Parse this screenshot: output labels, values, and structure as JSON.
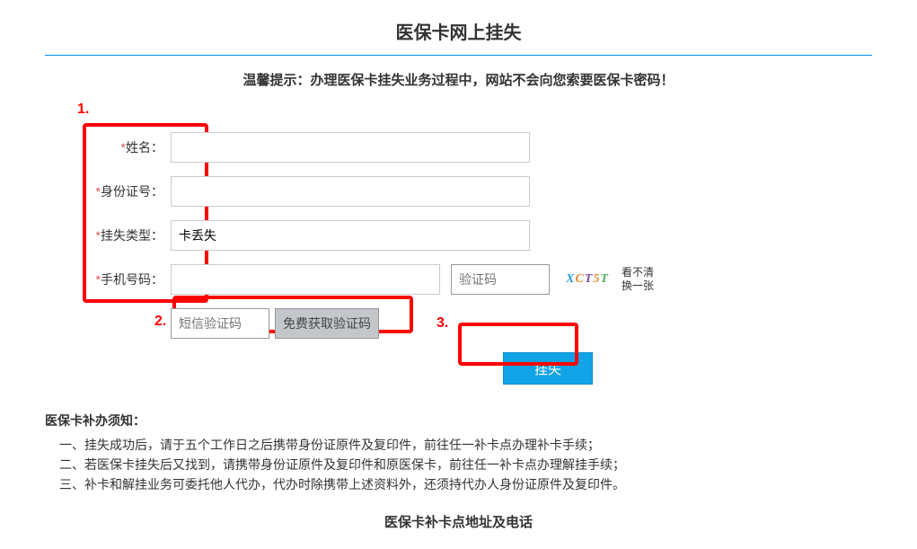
{
  "title": "医保卡网上挂失",
  "tip": "温馨提示：办理医保卡挂失业务过程中，网站不会向您索要医保卡密码！",
  "form": {
    "name": {
      "req": "*",
      "label": "姓名：",
      "value": ""
    },
    "idnum": {
      "req": "*",
      "label": "身份证号：",
      "value": ""
    },
    "losstype": {
      "req": "*",
      "label": "挂失类型：",
      "value": "卡丢失"
    },
    "phone": {
      "req": "*",
      "label": "手机号码：",
      "value": ""
    },
    "captcha": {
      "placeholder": "验证码",
      "value": ""
    },
    "captcha_hint1": "看不清",
    "captcha_hint2": "换一张",
    "sms": {
      "placeholder": "短信验证码",
      "value": "",
      "btn": "免费获取验证码"
    },
    "submit_label": "挂失"
  },
  "notice": {
    "title": "医保卡补办须知：",
    "lines": [
      "一、挂失成功后，请于五个工作日之后携带身份证原件及复印件，前往任一补卡点办理补卡手续；",
      "二、若医保卡挂失后又找到，请携带身份证原件及复印件和原医保卡，前往任一补卡点办理解挂手续；",
      "三、补卡和解挂业务可委托他人代办，代办时除携带上述资料外，还须持代办人身份证原件及复印件。"
    ]
  },
  "bottom_title": "医保卡补卡点地址及电话",
  "annotations": {
    "a1": "1.",
    "a2": "2.",
    "a3": "3."
  }
}
